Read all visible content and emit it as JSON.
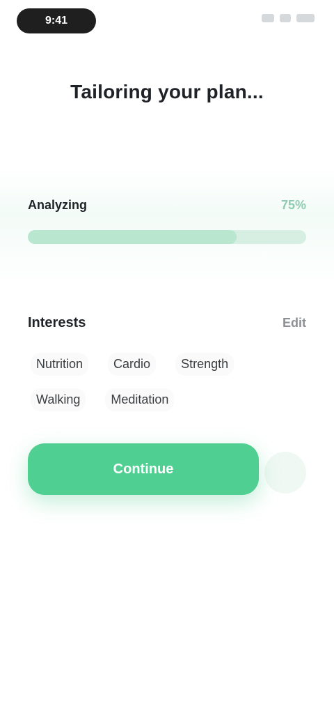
{
  "status_bar": {
    "time": "9:41",
    "icons": [
      "signal-icon",
      "wifi-icon",
      "battery-icon"
    ]
  },
  "header": {
    "title": "Tailoring your plan..."
  },
  "progress": {
    "label": "Analyzing",
    "value_text": "75%",
    "value": 0.75
  },
  "interests": {
    "label": "Interests",
    "edit_label": "Edit",
    "chips": [
      "Nutrition",
      "Cardio",
      "Strength",
      "Walking",
      "Meditation"
    ]
  },
  "actions": {
    "primary_label": "Continue"
  },
  "colors": {
    "accent": "#4fcf91",
    "track": "#d6efe2"
  }
}
